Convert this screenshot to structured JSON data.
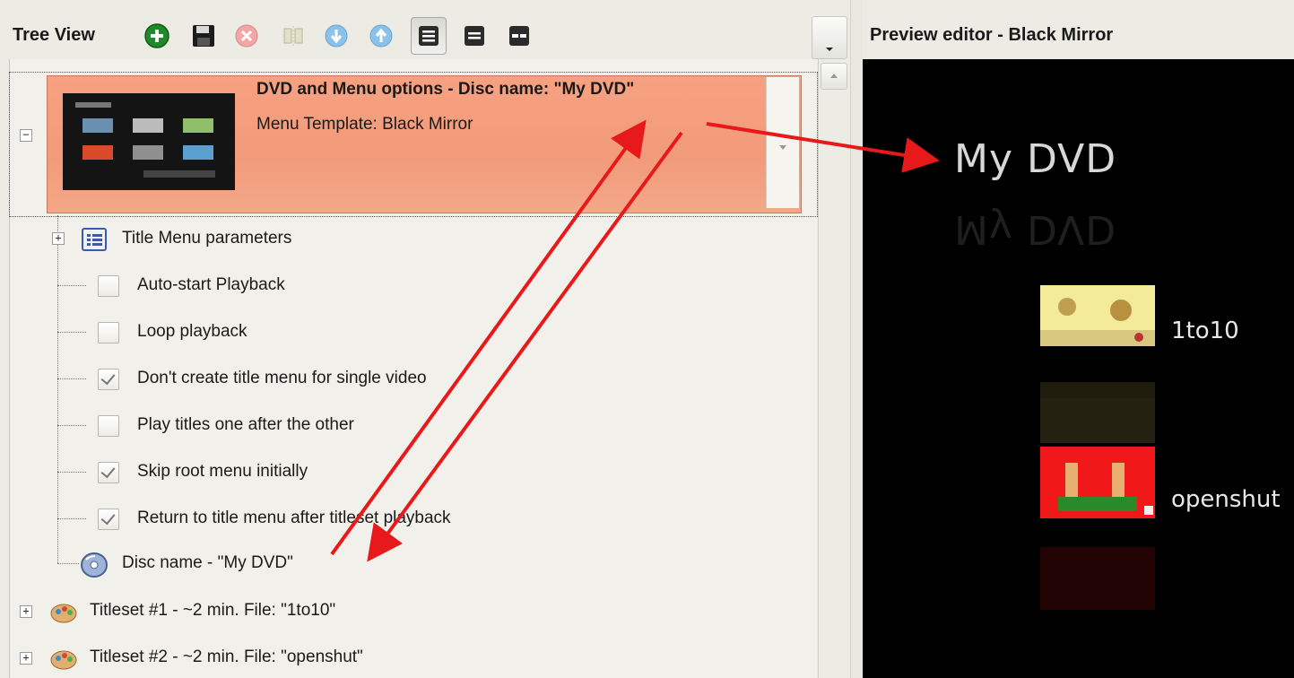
{
  "tree_view": {
    "title": "Tree View",
    "toolbar": [
      {
        "icon": "add-icon",
        "pressed": false
      },
      {
        "icon": "save-icon",
        "pressed": false
      },
      {
        "icon": "delete-icon",
        "pressed": false
      },
      {
        "icon": "split-icon",
        "pressed": false
      },
      {
        "icon": "move-down-icon",
        "pressed": false
      },
      {
        "icon": "move-up-icon",
        "pressed": false
      },
      {
        "icon": "list-view-icon",
        "pressed": true
      },
      {
        "icon": "compact-view-icon",
        "pressed": false
      },
      {
        "icon": "layout-view-icon",
        "pressed": false
      }
    ],
    "disc_node": {
      "title": "DVD and Menu options - Disc name: \"My DVD\"",
      "subtitle": "Menu Template: Black Mirror",
      "color": "#f29b7b"
    },
    "title_menu": {
      "label": "Title Menu parameters"
    },
    "options": [
      {
        "label": "Auto-start Playback",
        "checked": false
      },
      {
        "label": "Loop playback",
        "checked": false
      },
      {
        "label": "Don't create title menu for single video",
        "checked": true
      },
      {
        "label": "Play titles one after the other",
        "checked": false
      },
      {
        "label": "Skip root menu initially",
        "checked": true
      },
      {
        "label": "Return to title menu after titleset playback",
        "checked": true
      }
    ],
    "disc_name_item": {
      "label": "Disc name - \"My DVD\""
    },
    "titlesets": [
      {
        "label": "Titleset #1 - ~2 min. File: \"1to10\""
      },
      {
        "label": "Titleset #2 - ~2 min. File: \"openshut\""
      }
    ]
  },
  "preview": {
    "title": "Preview editor - Black Mirror",
    "menu_title": "My DVD",
    "items": [
      {
        "label": "1to10"
      },
      {
        "label": "openshut"
      }
    ],
    "background": "#000000"
  },
  "annotation_color": "#e8191a"
}
